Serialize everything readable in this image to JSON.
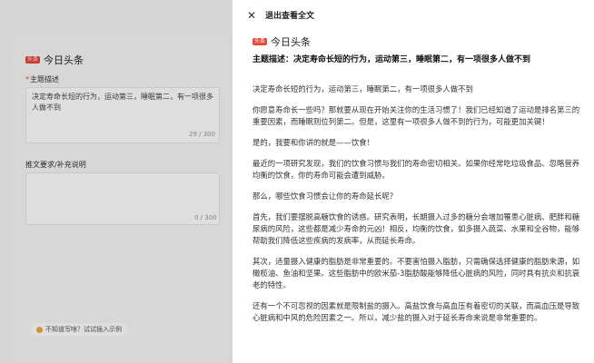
{
  "left": {
    "brand": "今日头条",
    "badge": "头条",
    "topic_label": "主题描述",
    "topic_text": "决定寿命长短的行为，运动第三，睡眠第二，有一项很多人做不到",
    "topic_counter": "29 / 300",
    "req_label": "推文要求/补充说明",
    "req_counter": "0 / 300",
    "hint": "不知道写啥？试试插入示例"
  },
  "panel": {
    "close_label": "✕",
    "exit_label": "退出查看全文",
    "badge": "头条",
    "brand": "今日头条",
    "topic_heading": "主题描述：决定寿命长短的行为，运动第三，睡眠第二，有一项很多人做不到",
    "paragraphs": [
      "决定寿命长短的行为，运动第三，睡眠第二，有一项很多人做不到",
      "你愿意寿命长一些吗？那就要从现在开始关注你的生活习惯了！我们已经知道了运动是排名第三的重要因素，而睡眠则位列第二。但是，这里有一项很多人做不到的行为，可能更加关键！",
      "是的，我要和你讲的就是——饮食！",
      "最近的一项研究发现，我们的饮食习惯与我们的寿命密切相关。如果你经常吃垃圾食品、忽略营养均衡的饮食，你的寿命可能会遭到威胁。",
      "那么，哪些饮食习惯会让你的寿命延长呢？",
      "首先，我们要摆脱高糖饮食的诱惑。研究表明，长期摄入过多的糖分会增加罹患心脏病、肥胖和糖尿病的风险，这些都是减少寿命的元凶！相反，均衡的饮食，如多摄入蔬菜、水果和全谷物，能够帮助我们降低这些疾病的发病率，从而延长寿命。",
      "其次，适量摄入健康的脂肪是非常重要的。不要害怕摄入脂肪，只需确保选择健康的脂肪来源，如橄榄油、鱼油和坚果。这些脂肪中的欧米茄-3脂肪酸能够降低心脏病的风险，同时具有抗炎和抗衰老的特性。",
      "还有一个不可忽视的因素就是限制盐的摄入。高盐饮食与高血压有着密切的关联，而高血压是导致心脏病和中风的危险因素之一。所以，减少盐的摄入对于延长寿命来说是非常重要的。"
    ]
  }
}
